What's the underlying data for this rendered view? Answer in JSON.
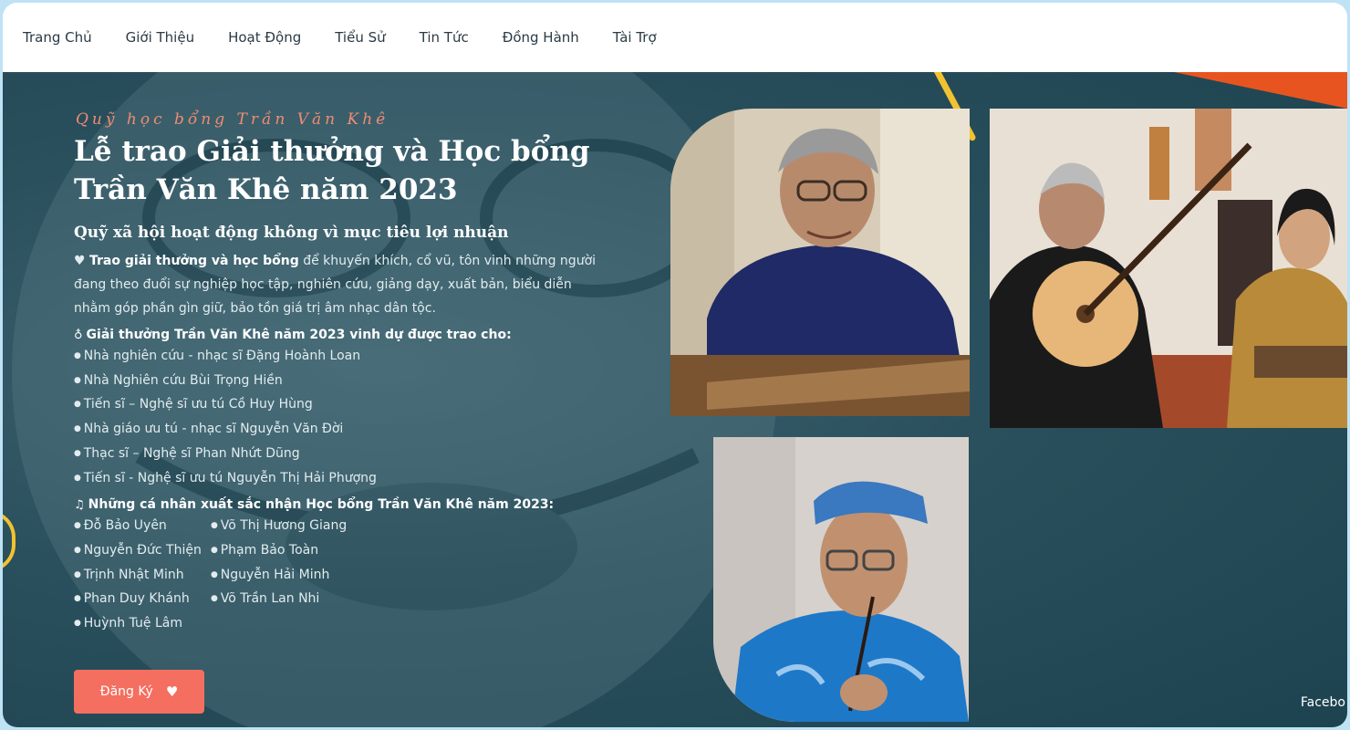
{
  "nav": {
    "items": [
      "Trang Chủ",
      "Giới Thiệu",
      "Hoạt Động",
      "Tiểu Sử",
      "Tin Tức",
      "Đồng Hành",
      "Tài Trợ"
    ]
  },
  "hero": {
    "eyebrow": "Quỹ học bổng Trần Văn Khê",
    "title": "Lễ trao Giải thưởng và Học bổng Trần Văn Khê năm 2023",
    "subtitle": "Quỹ xã hội hoạt động không vì mục tiêu lợi nhuận",
    "intro_bold": "Trao giải thưởng và học bổng",
    "intro_rest": "để khuyến khích, cổ vũ, tôn vinh những người đang theo đuổi sự nghiệp học tập, nghiên cứu, giảng dạy, xuất bản, biểu diễn nhằm góp phần gìn giữ, bảo tồn giá trị âm nhạc dân tộc.",
    "awards_heading": "Giải thưởng Trần Văn Khê năm 2023 vinh dự được trao cho:",
    "awardees": [
      "Nhà nghiên cứu - nhạc sĩ Đặng Hoành Loan",
      "Nhà Nghiên cứu Bùi Trọng Hiền",
      "Tiến sĩ – Nghệ sĩ ưu tú Cồ Huy Hùng",
      "Nhà giáo ưu tú - nhạc sĩ Nguyễn Văn Đời",
      "Thạc sĩ – Nghệ sĩ Phan Nhứt Dũng",
      "Tiến sĩ - Nghệ sĩ ưu tú Nguyễn Thị Hải Phượng"
    ],
    "scholarship_heading": "Những cá nhân xuất sắc nhận Học bổng Trần Văn Khê năm 2023:",
    "scholars_col1": [
      "Đỗ Bảo Uyên",
      "Nguyễn Đức Thiện",
      "Trịnh Nhật Minh",
      "Phan Duy Khánh",
      "Huỳnh Tuệ Lâm"
    ],
    "scholars_col2": [
      "Võ Thị Hương Giang",
      "Phạm Bảo Toàn",
      "Nguyễn Hải Minh",
      "Võ Trần Lan Nhi"
    ],
    "register_label": "Đăng Ký",
    "facebook_label": "Facebo"
  },
  "icons": {
    "heart": "heart-icon",
    "award": "award-icon",
    "music": "music-icon",
    "register": "hand-heart-icon"
  },
  "colors": {
    "accent": "#f46f5f",
    "eyebrow": "#f08c73",
    "hero_bg": "#2a505d",
    "deco_yellow": "#f2c230",
    "deco_orange": "#e8541f"
  }
}
